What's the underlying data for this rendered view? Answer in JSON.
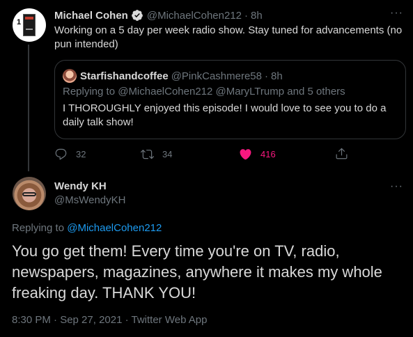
{
  "first_tweet": {
    "author_name": "Michael Cohen",
    "verified": true,
    "handle": "@MichaelCohen212",
    "separator": "·",
    "time_ago": "8h",
    "text": "Working on a 5 day per week radio show. Stay tuned for advancements (no pun intended)",
    "more_label": "···",
    "avatar_badge_number": "1",
    "quoted": {
      "author_name": "Starfishandcoffee",
      "handle": "@PinkCashmere58",
      "separator": "·",
      "time_ago": "8h",
      "replying_to": "Replying to @MichaelCohen212 @MaryLTrump and 5 others",
      "text": "I THOROUGHLY enjoyed this episode!  I would love to see you to do a daily talk show!"
    },
    "actions": {
      "reply_count": "32",
      "retweet_count": "34",
      "like_count": "416"
    }
  },
  "main_tweet": {
    "author_name": "Wendy KH",
    "handle": "@MsWendyKH",
    "more_label": "···",
    "replying_prefix": "Replying to ",
    "replying_handle": "@MichaelCohen212",
    "text": "You go get them! Every time you're on TV, radio, newspapers, magazines, anywhere it makes my whole freaking day. THANK YOU!",
    "timestamp": "8:30 PM · Sep 27, 2021 · Twitter Web App"
  },
  "colors": {
    "background": "#000000",
    "text": "#d9d9d9",
    "muted": "#6e767d",
    "link": "#1d9bf0",
    "like": "#f91880",
    "border": "#333639"
  },
  "icons": {
    "reply": "reply-icon",
    "retweet": "retweet-icon",
    "like": "heart-icon",
    "share": "share-icon",
    "verified": "verified-badge-icon",
    "more": "more-icon"
  }
}
